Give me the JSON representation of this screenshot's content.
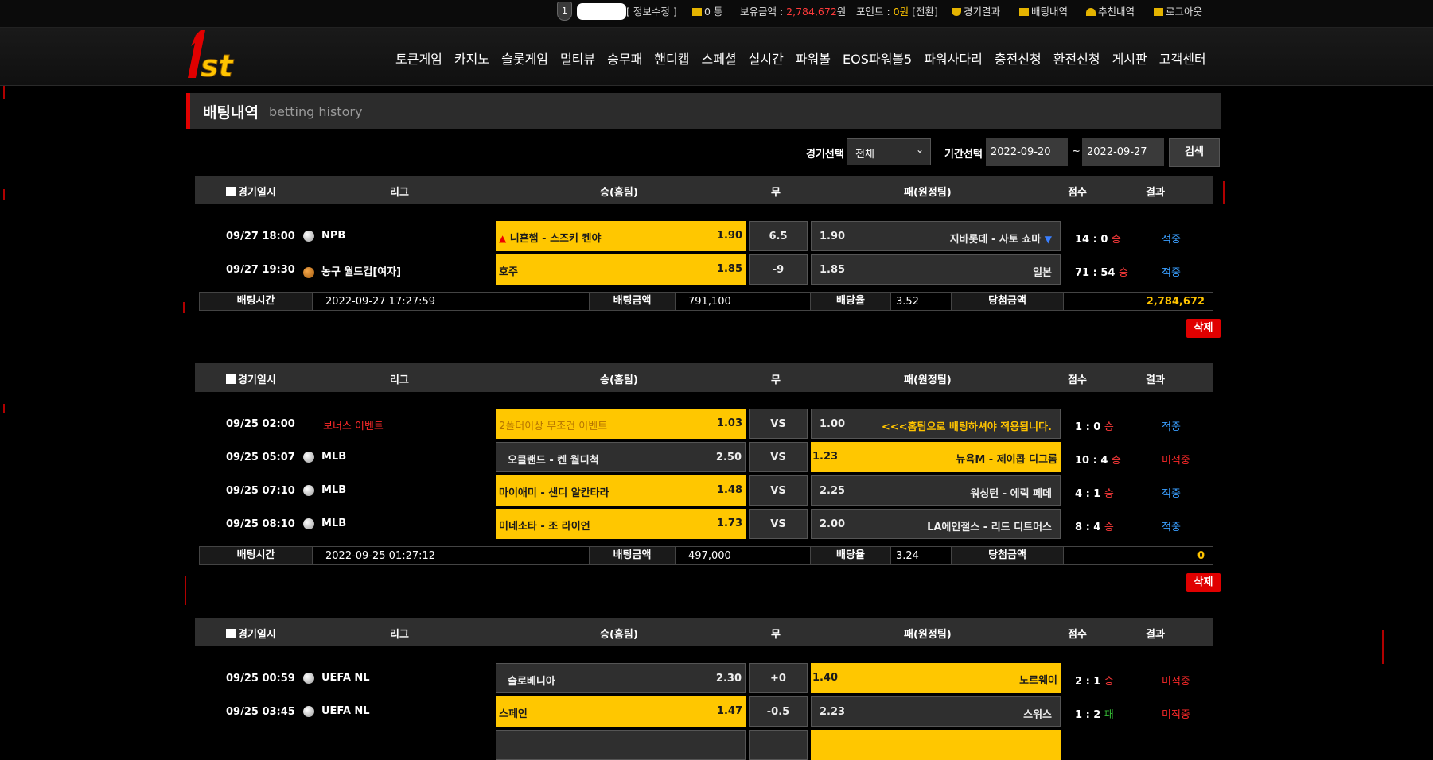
{
  "topbar": {
    "rank_badge": "1",
    "info_edit": "[ 정보수정 ]",
    "messages": "0 통",
    "balance_label": "보유금액 :",
    "balance_value": "2,784,672",
    "balance_unit": "원",
    "points_label": "포인트 :",
    "points_value": "0원",
    "points_convert": "[전환]",
    "game_results": "경기결과",
    "bet_history": "배팅내역",
    "recommend": "추천내역",
    "logout": "로그아웃"
  },
  "nav": {
    "logo_text": "1st",
    "items": [
      "토큰게임",
      "카지노",
      "슬롯게임",
      "멀티뷰",
      "승무패",
      "핸디캡",
      "스페셜",
      "실시간",
      "파워볼",
      "EOS파워볼5",
      "파워사다리",
      "충전신청",
      "환전신청",
      "게시판",
      "고객센터"
    ]
  },
  "page": {
    "title_ko": "배팅내역",
    "title_en": "betting history",
    "filter_game_label": "경기선택",
    "filter_game_value": "전체",
    "filter_period_label": "기간선택",
    "date_from": "2022-09-20",
    "date_sep": "~",
    "date_to": "2022-09-27",
    "search_btn": "검색",
    "delete_btn": "삭제"
  },
  "headers": {
    "datetime": "경기일시",
    "league": "리그",
    "home": "승(홈팀)",
    "draw": "무",
    "away": "패(원정팀)",
    "score": "점수",
    "result": "결과"
  },
  "summary_labels": {
    "bet_time": "배팅시간",
    "bet_amount": "배팅금액",
    "odds": "배당율",
    "win_amount": "당첨금액"
  },
  "slips": [
    {
      "games": [
        {
          "time": "09/27 18:00",
          "league": "NPB",
          "home": "니혼햄 - 스즈키 켄야",
          "home_odds": "1.90",
          "draw": "6.5",
          "away": "지바롯데 - 사토 쇼마",
          "away_odds": "1.90",
          "score": "14 : 0",
          "outcome": "승",
          "result": "적중"
        },
        {
          "time": "09/27 19:30",
          "league": "농구 월드컵[여자]",
          "home": "호주",
          "home_odds": "1.85",
          "draw": "-9",
          "away": "일본",
          "away_odds": "1.85",
          "score": "71 : 54",
          "outcome": "승",
          "result": "적중"
        }
      ],
      "bet_time": "2022-09-27 17:27:59",
      "bet_amount": "791,100",
      "odds": "3.52",
      "win_amount": "2,784,672"
    },
    {
      "games": [
        {
          "time": "09/25 02:00",
          "league": "보너스 이벤트",
          "home": "2폴더이상 무조건 이벤트",
          "home_odds": "1.03",
          "draw": "VS",
          "away": "<<<홈팀으로 배팅하셔야 적용됩니다.",
          "away_odds": "1.00",
          "score": "1 : 0",
          "outcome": "승",
          "result": "적중"
        },
        {
          "time": "09/25 05:07",
          "league": "MLB",
          "home": "오클랜드 - 켄 월디척",
          "home_odds": "2.50",
          "draw": "VS",
          "away": "뉴욕M - 제이콥 디그롬",
          "away_odds": "1.23",
          "score": "10 : 4",
          "outcome": "승",
          "result": "미적중"
        },
        {
          "time": "09/25 07:10",
          "league": "MLB",
          "home": "마이애미 - 샌디 알칸타라",
          "home_odds": "1.48",
          "draw": "VS",
          "away": "워싱턴 - 에릭 페데",
          "away_odds": "2.25",
          "score": "4 : 1",
          "outcome": "승",
          "result": "적중"
        },
        {
          "time": "09/25 08:10",
          "league": "MLB",
          "home": "미네소타 - 조 라이언",
          "home_odds": "1.73",
          "draw": "VS",
          "away": "LA에인절스 - 리드 디트머스",
          "away_odds": "2.00",
          "score": "8 : 4",
          "outcome": "승",
          "result": "적중"
        }
      ],
      "bet_time": "2022-09-25 01:27:12",
      "bet_amount": "497,000",
      "odds": "3.24",
      "win_amount": "0"
    },
    {
      "games": [
        {
          "time": "09/25 00:59",
          "league": "UEFA NL",
          "home": "슬로베니아",
          "home_odds": "2.30",
          "draw": "+0",
          "away": "노르웨이",
          "away_odds": "1.40",
          "score": "2 : 1",
          "outcome": "승",
          "result": "미적중"
        },
        {
          "time": "09/25 03:45",
          "league": "UEFA NL",
          "home": "스페인",
          "home_odds": "1.47",
          "draw": "-0.5",
          "away": "스위스",
          "away_odds": "2.23",
          "score": "1 : 2",
          "outcome": "패",
          "result": "미적중"
        }
      ]
    }
  ],
  "colors": {
    "accent_red": "#e00000",
    "highlight": "#ffc700",
    "hit": "#3a9fff",
    "miss": "#ff2a2a"
  }
}
